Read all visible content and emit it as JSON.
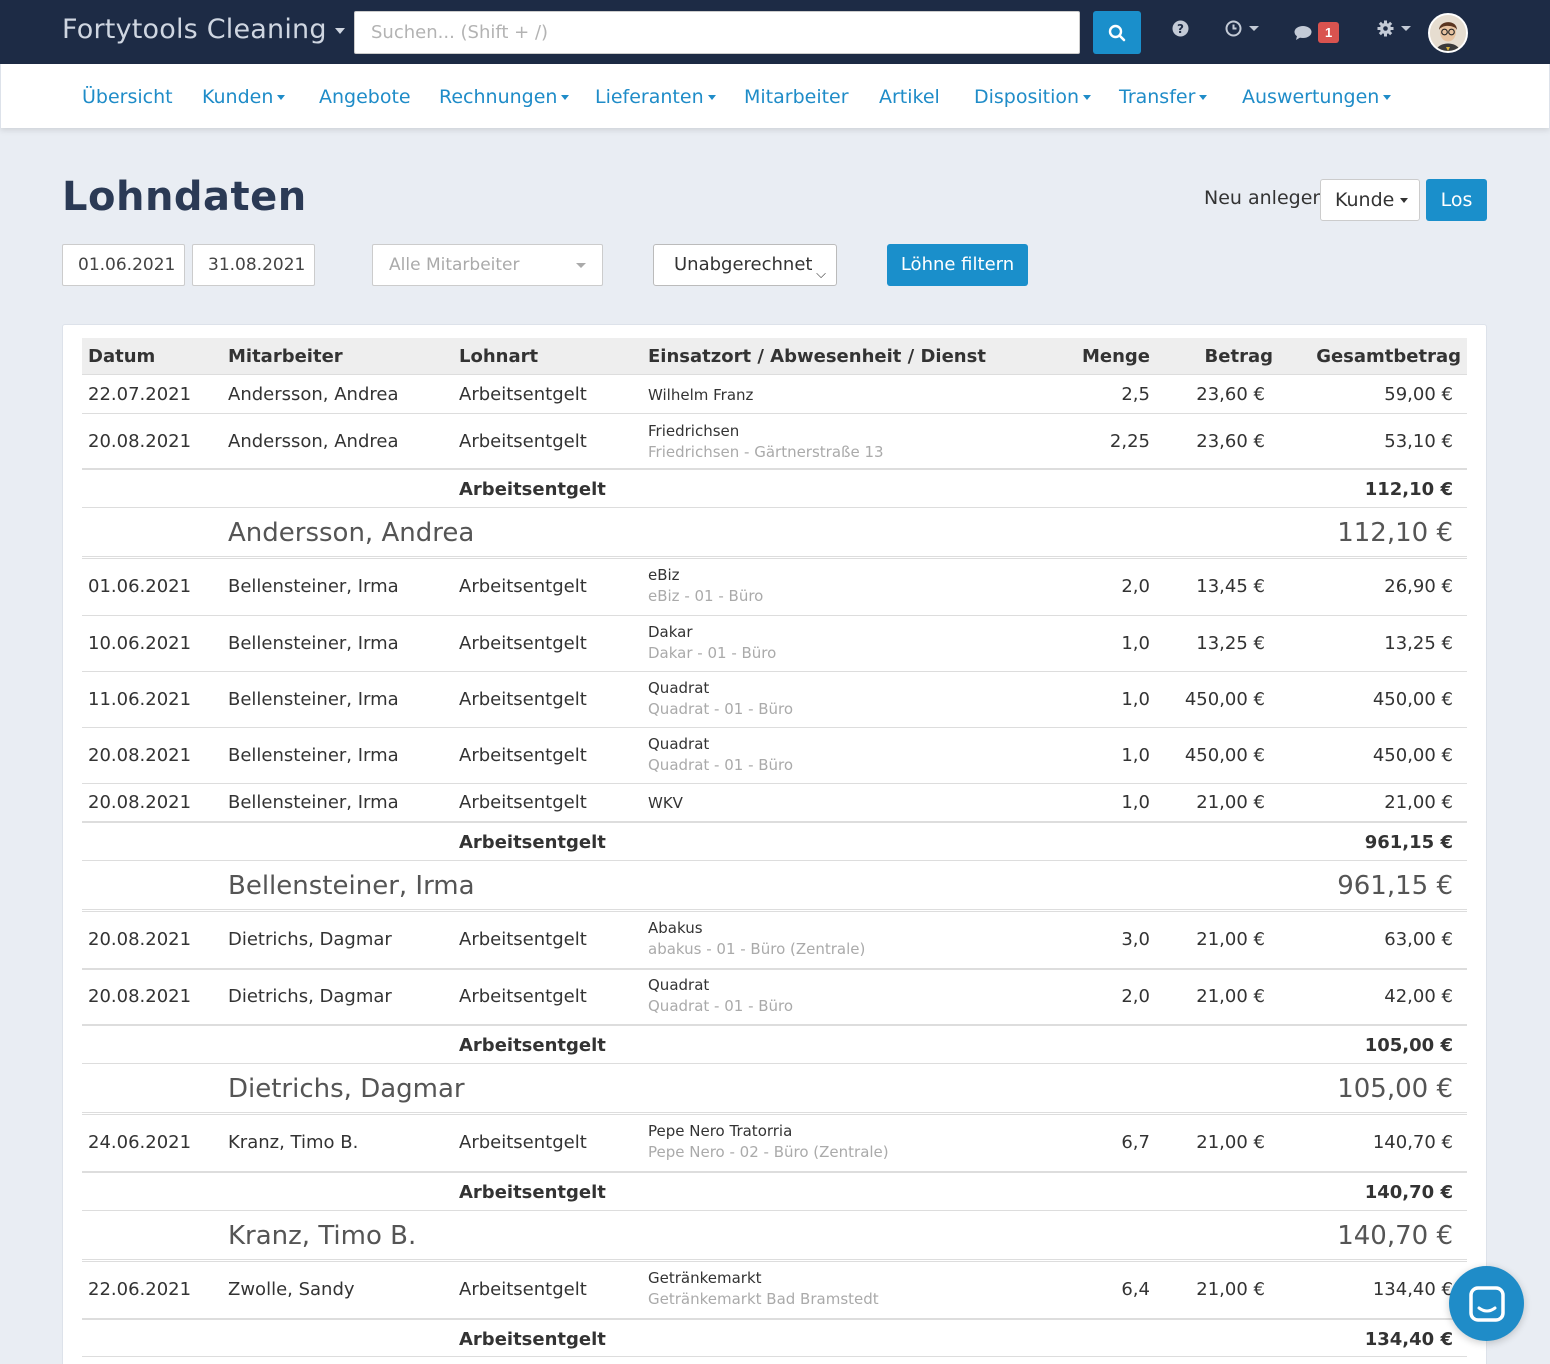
{
  "app": {
    "brand": "Fortytools Cleaning",
    "search_placeholder": "Suchen... (Shift + /)",
    "messages_badge": "1",
    "colors": {
      "topbar": "#1d2b45",
      "accent": "#1a8fcb",
      "badge": "#d9534f"
    }
  },
  "nav": {
    "items": [
      {
        "label": "Übersicht",
        "dropdown": false
      },
      {
        "label": "Kunden",
        "dropdown": true
      },
      {
        "label": "Angebote",
        "dropdown": false
      },
      {
        "label": "Rechnungen",
        "dropdown": true
      },
      {
        "label": "Lieferanten",
        "dropdown": true
      },
      {
        "label": "Mitarbeiter",
        "dropdown": false
      },
      {
        "label": "Artikel",
        "dropdown": false
      },
      {
        "label": "Disposition",
        "dropdown": true
      },
      {
        "label": "Transfer",
        "dropdown": true
      },
      {
        "label": "Auswertungen",
        "dropdown": true
      }
    ]
  },
  "page": {
    "title": "Lohndaten",
    "new_label": "Neu anlegen:",
    "new_select_value": "Kunde",
    "new_button": "Los"
  },
  "filters": {
    "date_from": "01.06.2021",
    "date_to": "31.08.2021",
    "employee_placeholder": "Alle Mitarbeiter",
    "status_value": "Unabgerechnet",
    "filter_button": "Löhne filtern"
  },
  "table": {
    "headers": {
      "date": "Datum",
      "employee": "Mitarbeiter",
      "wage_type": "Lohnart",
      "location": "Einsatzort / Abwesenheit / Dienst",
      "quantity": "Menge",
      "amount": "Betrag",
      "total": "Gesamtbetrag"
    },
    "rows": [
      {
        "date": "22.07.2021",
        "employee": "Andersson, Andrea",
        "wage_type": "Arbeitsentgelt",
        "loc1": "Wilhelm Franz",
        "loc2": "",
        "qty": "2,5",
        "amount": "23,60 €",
        "total": "59,00 €"
      },
      {
        "date": "20.08.2021",
        "employee": "Andersson, Andrea",
        "wage_type": "Arbeitsentgelt",
        "loc1": "Friedrichsen",
        "loc2": "Friedrichsen - Gärtnerstraße 13",
        "qty": "2,25",
        "amount": "23,60 €",
        "total": "53,10 €"
      },
      {
        "sub_label": "Arbeitsentgelt",
        "sub_total": "112,10 €"
      },
      {
        "group_name": "Andersson, Andrea",
        "group_total": "112,10 €"
      },
      {
        "date": "01.06.2021",
        "employee": "Bellensteiner, Irma",
        "wage_type": "Arbeitsentgelt",
        "loc1": "eBiz",
        "loc2": "eBiz - 01 - Büro",
        "qty": "2,0",
        "amount": "13,45 €",
        "total": "26,90 €"
      },
      {
        "date": "10.06.2021",
        "employee": "Bellensteiner, Irma",
        "wage_type": "Arbeitsentgelt",
        "loc1": "Dakar",
        "loc2": "Dakar - 01 - Büro",
        "qty": "1,0",
        "amount": "13,25 €",
        "total": "13,25 €"
      },
      {
        "date": "11.06.2021",
        "employee": "Bellensteiner, Irma",
        "wage_type": "Arbeitsentgelt",
        "loc1": "Quadrat",
        "loc2": "Quadrat - 01 - Büro",
        "qty": "1,0",
        "amount": "450,00 €",
        "total": "450,00 €"
      },
      {
        "date": "20.08.2021",
        "employee": "Bellensteiner, Irma",
        "wage_type": "Arbeitsentgelt",
        "loc1": "Quadrat",
        "loc2": "Quadrat - 01 - Büro",
        "qty": "1,0",
        "amount": "450,00 €",
        "total": "450,00 €"
      },
      {
        "date": "20.08.2021",
        "employee": "Bellensteiner, Irma",
        "wage_type": "Arbeitsentgelt",
        "loc1": "WKV",
        "loc2": "",
        "qty": "1,0",
        "amount": "21,00 €",
        "total": "21,00 €"
      },
      {
        "sub_label": "Arbeitsentgelt",
        "sub_total": "961,15 €"
      },
      {
        "group_name": "Bellensteiner, Irma",
        "group_total": "961,15 €"
      },
      {
        "date": "20.08.2021",
        "employee": "Dietrichs, Dagmar",
        "wage_type": "Arbeitsentgelt",
        "loc1": "Abakus",
        "loc2": "abakus - 01 - Büro (Zentrale)",
        "qty": "3,0",
        "amount": "21,00 €",
        "total": "63,00 €"
      },
      {
        "date": "20.08.2021",
        "employee": "Dietrichs, Dagmar",
        "wage_type": "Arbeitsentgelt",
        "loc1": "Quadrat",
        "loc2": "Quadrat - 01 - Büro",
        "qty": "2,0",
        "amount": "21,00 €",
        "total": "42,00 €"
      },
      {
        "sub_label": "Arbeitsentgelt",
        "sub_total": "105,00 €"
      },
      {
        "group_name": "Dietrichs, Dagmar",
        "group_total": "105,00 €"
      },
      {
        "date": "24.06.2021",
        "employee": "Kranz, Timo B.",
        "wage_type": "Arbeitsentgelt",
        "loc1": "Pepe Nero Tratorria",
        "loc2": "Pepe Nero - 02 - Büro (Zentrale)",
        "qty": "6,7",
        "amount": "21,00 €",
        "total": "140,70 €"
      },
      {
        "sub_label": "Arbeitsentgelt",
        "sub_total": "140,70 €"
      },
      {
        "group_name": "Kranz, Timo B.",
        "group_total": "140,70 €"
      },
      {
        "date": "22.06.2021",
        "employee": "Zwolle, Sandy",
        "wage_type": "Arbeitsentgelt",
        "loc1": "Getränkemarkt",
        "loc2": "Getränkemarkt Bad Bramstedt",
        "qty": "6,4",
        "amount": "21,00 €",
        "total": "134,40 €"
      },
      {
        "sub_label": "Arbeitsentgelt",
        "sub_total": "134,40 €"
      }
    ]
  }
}
